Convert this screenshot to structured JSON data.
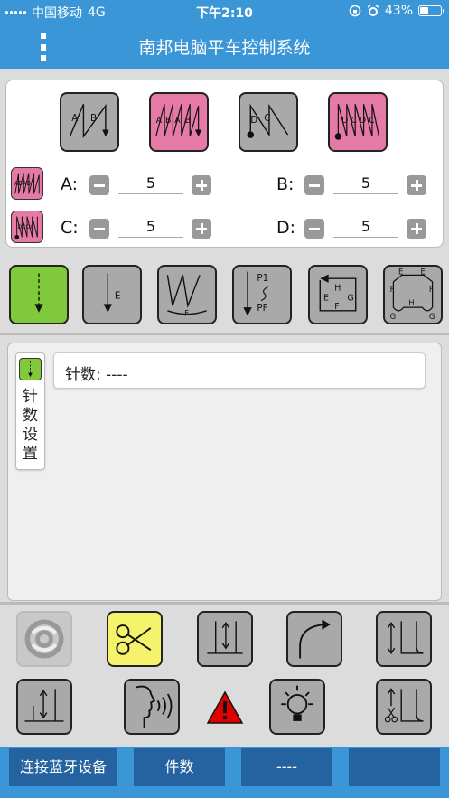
{
  "statusbar": {
    "carrier": "中国移动",
    "network": "4G",
    "time": "下午2:10",
    "battery": "43%",
    "battery_level": 0.43
  },
  "header": {
    "title": "南邦电脑平车控制系统",
    "menu_icon": "vertical-dots-icon"
  },
  "patterns": {
    "buttons": [
      {
        "name": "pattern-ab-button",
        "labels": [
          "A",
          "B"
        ]
      },
      {
        "name": "pattern-abab-button",
        "labels": [
          "A",
          "B",
          "A",
          "B"
        ]
      },
      {
        "name": "pattern-dc-button",
        "labels": [
          "D",
          "C"
        ]
      },
      {
        "name": "pattern-dcdc-button",
        "labels": [
          "D",
          "C",
          "D",
          "C"
        ]
      }
    ],
    "small_icons": [
      {
        "labels": "ABAB"
      },
      {
        "labels": "DCDC"
      }
    ],
    "params": [
      {
        "label": "A:",
        "value": "5"
      },
      {
        "label": "B:",
        "value": "5"
      },
      {
        "label": "C:",
        "value": "5"
      },
      {
        "label": "D:",
        "value": "5"
      }
    ]
  },
  "modes": {
    "buttons": [
      {
        "name": "mode-free-sewing",
        "labels": []
      },
      {
        "name": "mode-end-sewing",
        "labels": [
          "E"
        ]
      },
      {
        "name": "mode-f-sewing",
        "labels": [
          "F"
        ]
      },
      {
        "name": "mode-p1-pf",
        "labels": [
          "P1",
          "PF"
        ]
      },
      {
        "name": "mode-square",
        "labels": [
          "H",
          "E",
          "G",
          "F"
        ]
      },
      {
        "name": "mode-complex",
        "labels": [
          "E",
          "E",
          "F",
          "F",
          "G",
          "H",
          "G"
        ]
      }
    ]
  },
  "stitch": {
    "tab_label": "针数设置",
    "label": "针数:",
    "value": "----"
  },
  "footer": {
    "connect": "连接蓝牙设备",
    "pieces": "件数",
    "count": "----",
    "extra": ""
  },
  "colors": {
    "primary": "#3a96d6",
    "footer_button": "#2463a0",
    "active": "#7fc93a",
    "pink": "#e67aa6",
    "yellow": "#f5f36b",
    "warning": "#e00000"
  }
}
